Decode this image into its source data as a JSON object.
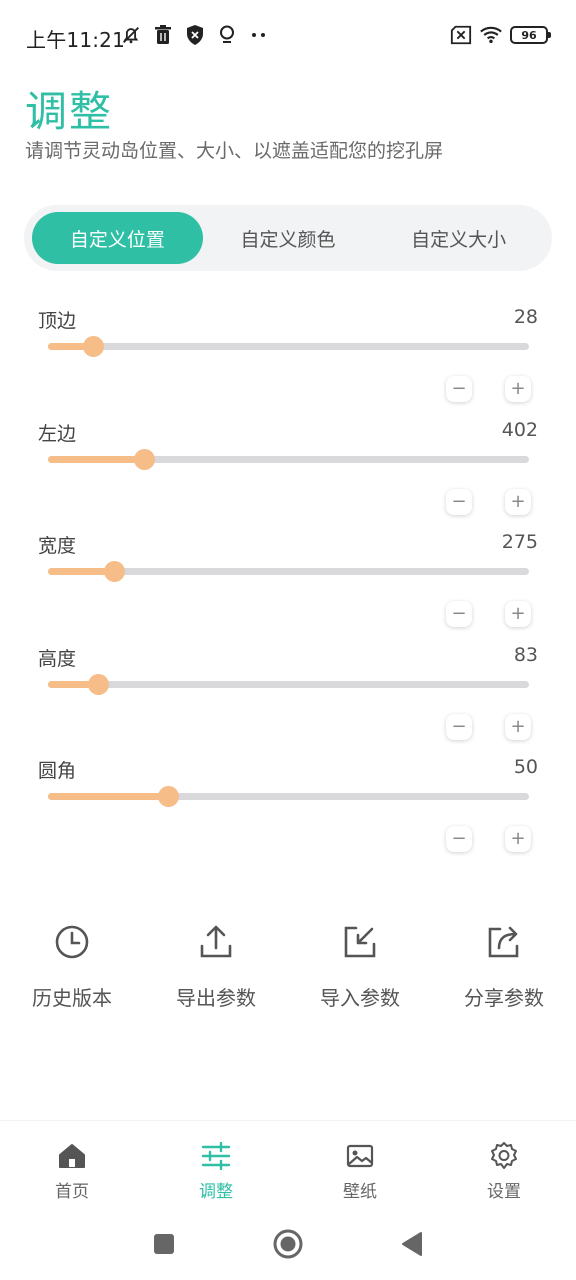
{
  "status_bar": {
    "time": "上午11:21",
    "battery": "96"
  },
  "header": {
    "title": "调整",
    "subtitle": "请调节灵动岛位置、大小、以遮盖适配您的挖孔屏"
  },
  "tabs": [
    {
      "label": "自定义位置",
      "active": true
    },
    {
      "label": "自定义颜色",
      "active": false
    },
    {
      "label": "自定义大小",
      "active": false
    }
  ],
  "sliders": [
    {
      "label": "顶边",
      "value": "28",
      "fraction": 0.094
    },
    {
      "label": "左边",
      "value": "402",
      "fraction": 0.2
    },
    {
      "label": "宽度",
      "value": "275",
      "fraction": 0.137
    },
    {
      "label": "高度",
      "value": "83",
      "fraction": 0.104
    },
    {
      "label": "圆角",
      "value": "50",
      "fraction": 0.25
    }
  ],
  "step_buttons": {
    "minus": "−",
    "plus": "+"
  },
  "actions": [
    {
      "label": "历史版本",
      "icon": "clock-icon"
    },
    {
      "label": "导出参数",
      "icon": "upload-icon"
    },
    {
      "label": "导入参数",
      "icon": "import-icon"
    },
    {
      "label": "分享参数",
      "icon": "share-icon"
    }
  ],
  "bottom_nav": [
    {
      "label": "首页",
      "icon": "home-icon",
      "active": false
    },
    {
      "label": "调整",
      "icon": "sliders-icon",
      "active": true
    },
    {
      "label": "壁纸",
      "icon": "image-icon",
      "active": false
    },
    {
      "label": "设置",
      "icon": "gear-icon",
      "active": false
    }
  ],
  "colors": {
    "accent": "#2ebfa5",
    "slider_fill": "#f6bd89",
    "track": "#d9d9db"
  }
}
